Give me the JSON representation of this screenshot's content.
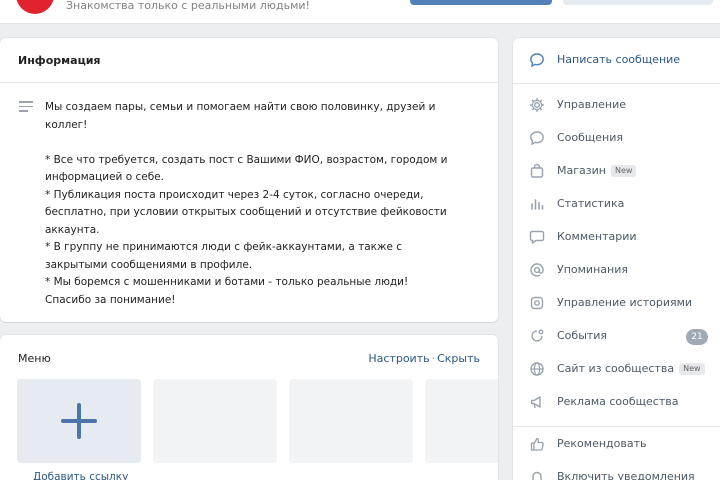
{
  "header": {
    "tagline": "Знакомства только с реальными людьми!"
  },
  "info": {
    "title": "Информация",
    "description": [
      "Мы создаем пары, семьи и помогаем найти свою половинку, друзей и коллег!",
      "",
      "* Все что требуется, создать пост с Вашими ФИО, возрастом, городом и информацией о себе.",
      "* Публикация поста происходит через 2-4 суток, согласно очереди, бесплатно, при условии открытых сообщений и отсутствие фейковости аккаунта.",
      "* В группу не принимаются люди с фейк-аккаунтами, а также с закрытыми сообщениями в профиле.",
      "* Мы боремся с мошенниками и ботами - только реальные люди!",
      "Спасибо за понимание!"
    ]
  },
  "menu": {
    "title": "Меню",
    "configure": "Настроить",
    "separator": "·",
    "hide": "Скрыть",
    "add_link": "Добавить ссылку"
  },
  "sidebar": {
    "write_message": "Написать сообщение",
    "items": [
      {
        "label": "Управление",
        "icon": "gear-icon"
      },
      {
        "label": "Сообщения",
        "icon": "message-icon"
      },
      {
        "label": "Магазин",
        "icon": "shopping-bag-icon",
        "badge": "New"
      },
      {
        "label": "Статистика",
        "icon": "bar-chart-icon"
      },
      {
        "label": "Комментарии",
        "icon": "comment-icon"
      },
      {
        "label": "Упоминания",
        "icon": "at-icon"
      },
      {
        "label": "Управление историями",
        "icon": "stories-icon"
      },
      {
        "label": "События",
        "icon": "events-icon",
        "count": "21"
      },
      {
        "label": "Сайт из сообщества",
        "icon": "globe-icon",
        "badge": "New"
      },
      {
        "label": "Реклама сообщества",
        "icon": "megaphone-icon"
      }
    ],
    "recommend": "Рекомендовать",
    "notifications": "Включить уведомления"
  },
  "colors": {
    "link": "#2a5885",
    "accent": "#5181b8",
    "avatar": "#e0232e",
    "icon": "#99a2ad"
  }
}
